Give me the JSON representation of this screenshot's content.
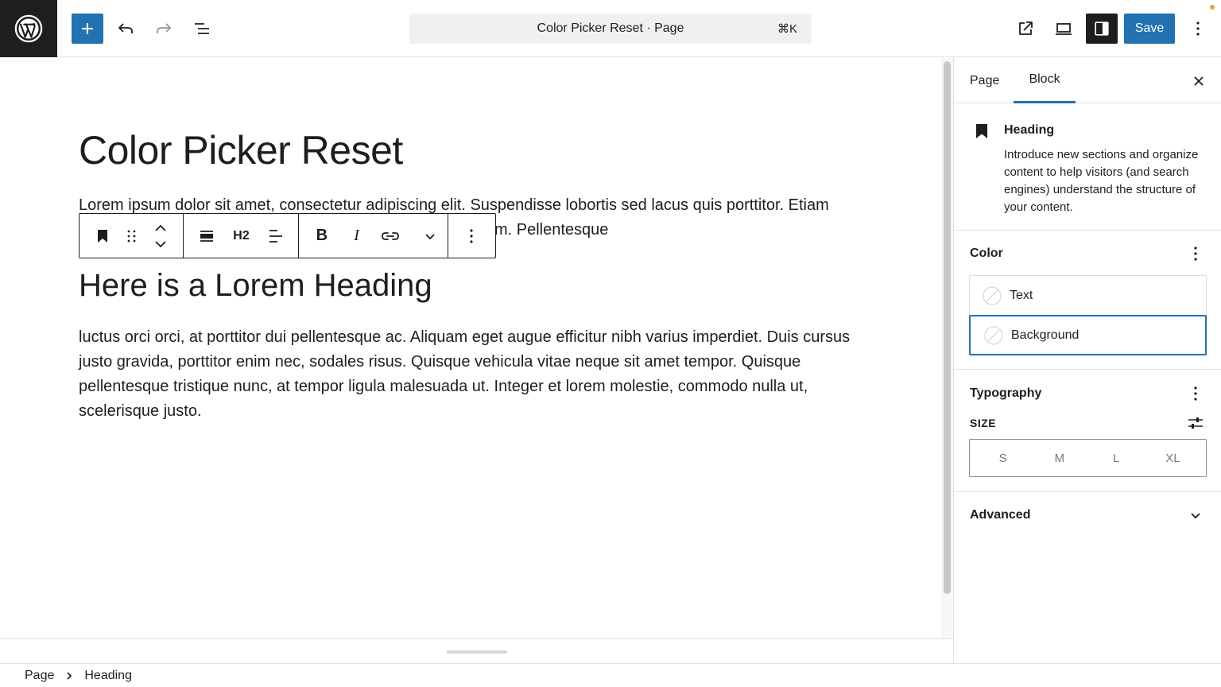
{
  "topbar": {
    "document_title": "Color Picker Reset · Page",
    "shortcut": "⌘K",
    "save_label": "Save"
  },
  "canvas": {
    "title": "Color Picker Reset",
    "paragraph1_line1": "Lorem ipsum dolor sit amet, consectetur adipiscing elit. Suspendisse lobortis sed lacus quis porttitor. Etiam",
    "paragraph1_line2_tail": "m. Pellentesque",
    "heading": "Here is a Lorem Heading",
    "paragraph2": "luctus orci orci, at porttitor dui pellentesque ac. Aliquam eget augue efficitur nibh varius imperdiet. Duis cursus justo gravida, porttitor enim nec, sodales risus. Quisque vehicula vitae neque sit amet tempor. Quisque pellentesque tristique nunc, at tempor ligula malesuada ut. Integer et lorem molestie, commodo nulla ut, scelerisque justo."
  },
  "block_toolbar": {
    "heading_level": "H2",
    "bold": "B",
    "italic": "I"
  },
  "sidebar": {
    "tabs": [
      {
        "label": "Page",
        "active": false
      },
      {
        "label": "Block",
        "active": true
      }
    ],
    "block": {
      "name": "Heading",
      "description": "Introduce new sections and organize content to help visitors (and search engines) understand the structure of your content."
    },
    "color": {
      "title": "Color",
      "items": [
        {
          "label": "Text"
        },
        {
          "label": "Background"
        }
      ]
    },
    "typography": {
      "title": "Typography",
      "size_label": "SIZE",
      "sizes": [
        "S",
        "M",
        "L",
        "XL"
      ]
    },
    "advanced": {
      "title": "Advanced"
    }
  },
  "footer": {
    "breadcrumbs": [
      "Page",
      "Heading"
    ]
  },
  "colors": {
    "accent": "#2271b1",
    "dark": "#1e1e1e",
    "border": "#e0e0e0",
    "notification": "#f0a030"
  }
}
